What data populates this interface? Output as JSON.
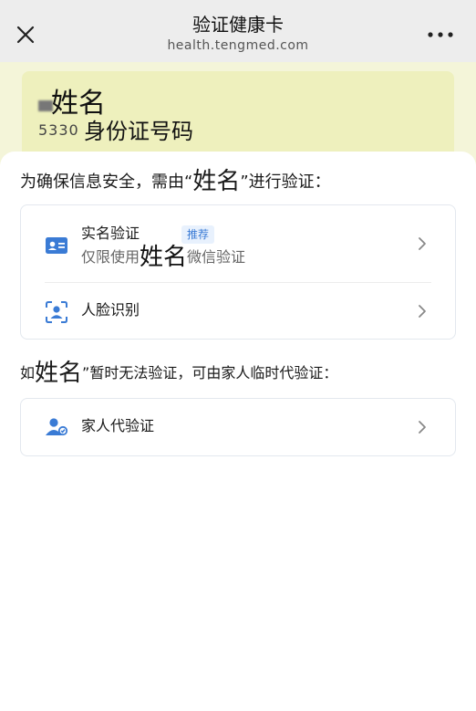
{
  "header": {
    "title": "验证健康卡",
    "subtitle": "health.tengmed.com"
  },
  "card": {
    "name": "姓名",
    "id_number_partial": "5330",
    "id_label": "身份证号码"
  },
  "intro": {
    "prefix": "为确保信息安全，需由“",
    "name": "姓名",
    "suffix": "”进行验证："
  },
  "options": {
    "realname": {
      "label": "实名验证",
      "badge": "推荐",
      "desc_prefix": "仅限使用",
      "desc_name": "姓名",
      "desc_suffix": "微信验证"
    },
    "face": {
      "label": "人脸识别"
    }
  },
  "family_hint": {
    "prefix": "如",
    "name": "姓名",
    "suffix": "”暂时无法验证，可由家人临时代验证："
  },
  "family": {
    "label": "家人代验证"
  },
  "colors": {
    "accent": "#3a7bd5",
    "card_bg": "#eef0bd",
    "topbar_bg": "#ededed"
  },
  "icons": {
    "close": "close-icon",
    "more": "more-icon",
    "id_card": "id-card-icon",
    "face": "face-scan-icon",
    "family": "family-icon",
    "chevron": "chevron-right-icon"
  }
}
